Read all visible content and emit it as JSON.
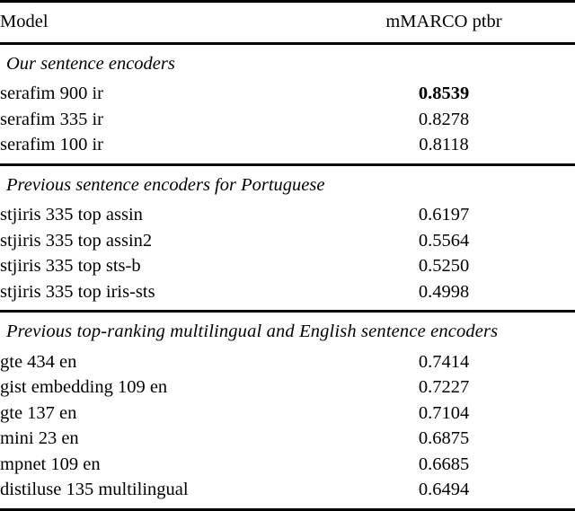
{
  "table": {
    "columns": [
      {
        "key": "model",
        "label": "Model",
        "align": "left"
      },
      {
        "key": "metric",
        "label": "mMARCO ptbr",
        "align": "center"
      }
    ],
    "header": {
      "model_label": "Model",
      "metric_label": "mMARCO ptbr"
    },
    "sections": [
      {
        "heading": "Our sentence encoders",
        "rows": [
          {
            "model": "serafim 900 ir",
            "value": "0.8539",
            "bold": true
          },
          {
            "model": "serafim 335 ir",
            "value": "0.8278",
            "bold": false
          },
          {
            "model": "serafim 100 ir",
            "value": "0.8118",
            "bold": false
          }
        ]
      },
      {
        "heading": "Previous sentence encoders for Portuguese",
        "rows": [
          {
            "model": "stjiris 335 top assin",
            "value": "0.6197",
            "bold": false
          },
          {
            "model": "stjiris 335 top assin2",
            "value": "0.5564",
            "bold": false
          },
          {
            "model": "stjiris 335 top sts-b",
            "value": "0.5250",
            "bold": false
          },
          {
            "model": "stjiris 335 top iris-sts",
            "value": "0.4998",
            "bold": false
          }
        ]
      },
      {
        "heading": "Previous top-ranking multilingual and English sentence encoders",
        "rows": [
          {
            "model": "gte 434 en",
            "value": "0.7414",
            "bold": false
          },
          {
            "model": "gist embedding 109 en",
            "value": "0.7227",
            "bold": false
          },
          {
            "model": "gte 137 en",
            "value": "0.7104",
            "bold": false
          },
          {
            "model": "mini 23 en",
            "value": "0.6875",
            "bold": false
          },
          {
            "model": "mpnet 109 en",
            "value": "0.6685",
            "bold": false
          },
          {
            "model": "distiluse 135 multilingual",
            "value": "0.6494",
            "bold": false
          }
        ]
      }
    ],
    "style": {
      "rule_color": "#000000",
      "text_color": "#000000",
      "background": "#ffffff"
    }
  },
  "chart_data": {
    "type": "table",
    "title": "",
    "categories": [
      "serafim 900 ir",
      "serafim 335 ir",
      "serafim 100 ir",
      "stjiris 335 top assin",
      "stjiris 335 top assin2",
      "stjiris 335 top sts-b",
      "stjiris 335 top iris-sts",
      "gte 434 en",
      "gist embedding 109 en",
      "gte 137 en",
      "mini 23 en",
      "mpnet 109 en",
      "distiluse 135 multilingual"
    ],
    "series": [
      {
        "name": "mMARCO ptbr",
        "values": [
          0.8539,
          0.8278,
          0.8118,
          0.6197,
          0.5564,
          0.525,
          0.4998,
          0.7414,
          0.7227,
          0.7104,
          0.6875,
          0.6685,
          0.6494
        ]
      }
    ],
    "groups": [
      {
        "name": "Our sentence encoders",
        "members": [
          "serafim 900 ir",
          "serafim 335 ir",
          "serafim 100 ir"
        ]
      },
      {
        "name": "Previous sentence encoders for Portuguese",
        "members": [
          "stjiris 335 top assin",
          "stjiris 335 top assin2",
          "stjiris 335 top sts-b",
          "stjiris 335 top iris-sts"
        ]
      },
      {
        "name": "Previous top-ranking multilingual and English sentence encoders",
        "members": [
          "gte 434 en",
          "gist embedding 109 en",
          "gte 137 en",
          "mini 23 en",
          "mpnet 109 en",
          "distiluse 135 multilingual"
        ]
      }
    ],
    "xlabel": "Model",
    "ylabel": "mMARCO ptbr",
    "highlighted": "serafim 900 ir",
    "grid": false,
    "legend": "none"
  }
}
